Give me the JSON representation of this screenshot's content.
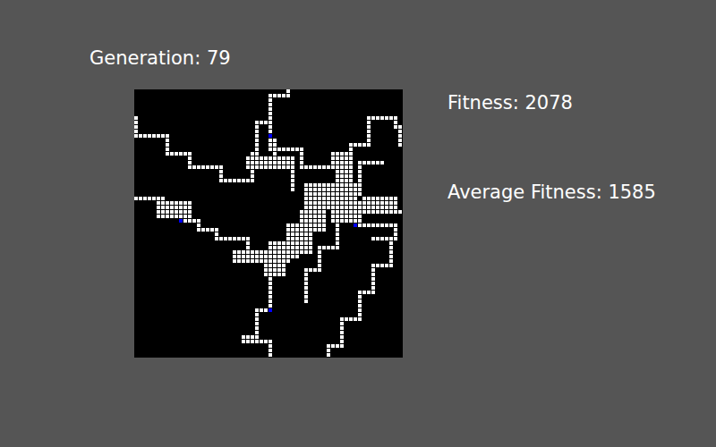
{
  "generation": "Generation: 79",
  "fitness": "Fitness: 2078",
  "average_fitness": "Average Fitness: 1585",
  "board": {
    "size": 60,
    "paths": [
      [
        [
          34,
          0
        ],
        [
          34,
          1
        ],
        [
          30,
          1
        ],
        [
          30,
          7
        ],
        [
          27,
          7
        ],
        [
          27,
          14
        ]
      ],
      [
        [
          30,
          8
        ],
        [
          30,
          13
        ],
        [
          37,
          13
        ],
        [
          37,
          17
        ],
        [
          44,
          17
        ],
        [
          44,
          14
        ],
        [
          47,
          14
        ]
      ],
      [
        [
          0,
          6
        ],
        [
          0,
          10
        ],
        [
          7,
          10
        ],
        [
          7,
          14
        ],
        [
          12,
          14
        ],
        [
          12,
          17
        ],
        [
          19,
          17
        ],
        [
          19,
          20
        ],
        [
          26,
          20
        ],
        [
          26,
          14
        ]
      ],
      [
        [
          0,
          24
        ],
        [
          6,
          24
        ],
        [
          6,
          28
        ],
        [
          10,
          29
        ],
        [
          14,
          31
        ],
        [
          18,
          32
        ],
        [
          18,
          33
        ],
        [
          25,
          35
        ],
        [
          25,
          37
        ]
      ],
      [
        [
          30,
          40
        ],
        [
          30,
          49
        ],
        [
          27,
          49
        ],
        [
          27,
          55
        ],
        [
          24,
          55
        ],
        [
          24,
          56
        ],
        [
          30,
          56
        ],
        [
          30,
          59
        ]
      ],
      [
        [
          52,
          6
        ],
        [
          58,
          6
        ],
        [
          58,
          8
        ],
        [
          59,
          8
        ],
        [
          59,
          12
        ]
      ],
      [
        [
          52,
          6
        ],
        [
          52,
          12
        ],
        [
          48,
          12
        ],
        [
          48,
          17
        ]
      ],
      [
        [
          51,
          16
        ],
        [
          55,
          16
        ]
      ],
      [
        [
          50,
          16
        ],
        [
          50,
          23
        ]
      ],
      [
        [
          49,
          30
        ],
        [
          58,
          30
        ],
        [
          58,
          33
        ],
        [
          57,
          33
        ],
        [
          57,
          39
        ],
        [
          53,
          39
        ],
        [
          53,
          45
        ],
        [
          50,
          45
        ],
        [
          50,
          51
        ],
        [
          46,
          51
        ],
        [
          46,
          57
        ],
        [
          43,
          57
        ],
        [
          43,
          59
        ]
      ],
      [
        [
          54,
          27
        ],
        [
          59,
          27
        ]
      ],
      [
        [
          53,
          33
        ],
        [
          57,
          33
        ]
      ],
      [
        [
          45,
          30
        ],
        [
          45,
          35
        ],
        [
          41,
          35
        ],
        [
          41,
          40
        ],
        [
          38,
          40
        ],
        [
          38,
          47
        ]
      ],
      [
        [
          31,
          11
        ],
        [
          31,
          14
        ]
      ],
      [
        [
          35,
          17
        ],
        [
          35,
          22
        ]
      ]
    ],
    "patches": [
      [
        38,
        21,
        12,
        6
      ],
      [
        37,
        27,
        6,
        5
      ],
      [
        34,
        30,
        6,
        7
      ],
      [
        30,
        34,
        7,
        4
      ],
      [
        22,
        36,
        13,
        3
      ],
      [
        29,
        39,
        5,
        3
      ],
      [
        44,
        25,
        7,
        5
      ],
      [
        51,
        24,
        8,
        4
      ],
      [
        25,
        15,
        11,
        3
      ],
      [
        45,
        15,
        4,
        6
      ],
      [
        5,
        25,
        8,
        4
      ]
    ],
    "agents": [
      [
        30,
        10
      ],
      [
        10,
        29
      ],
      [
        49,
        30
      ],
      [
        30,
        49
      ]
    ]
  }
}
